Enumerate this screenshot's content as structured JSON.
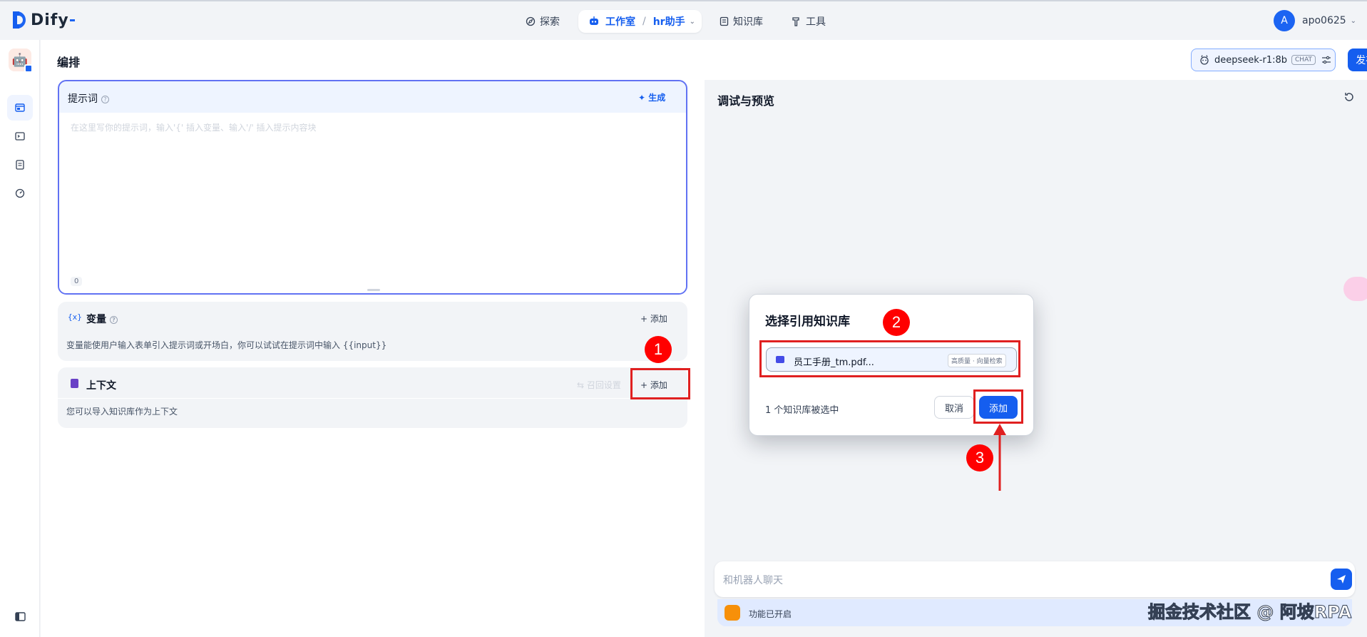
{
  "header": {
    "logo_text": "Dify",
    "nav": {
      "explore": "探索",
      "studio": "工作室",
      "app_name": "hr助手",
      "knowledge": "知识库",
      "tools": "工具"
    },
    "user": {
      "initial": "A",
      "name": "apo0625"
    }
  },
  "main": {
    "title": "编排",
    "model": {
      "name": "deepseek-r1:8b",
      "mode": "CHAT"
    },
    "publish": "发布"
  },
  "prompt": {
    "title": "提示词",
    "generate": "生成",
    "placeholder": "在这里写你的提示词，输入'{' 插入变量、输入'/' 插入提示内容块",
    "count": "0"
  },
  "variables": {
    "icon": "{x}",
    "title": "变量",
    "add": "+ 添加",
    "description": "变量能使用户输入表单引入提示词或开场白，你可以试试在提示词中输入 {{input}}"
  },
  "context": {
    "title": "上下文",
    "recall": "召回设置",
    "add": "+ 添加",
    "description": "您可以导入知识库作为上下文"
  },
  "debug": {
    "title": "调试与预览",
    "chat_placeholder": "和机器人聊天",
    "feature_text": "功能已开启",
    "watermark": "掘金技术社区 @ 阿坡RPA"
  },
  "modal": {
    "title": "选择引用知识库",
    "dataset_name": "员工手册_tm.pdf...",
    "dataset_tag": "高质量 · 向量检索",
    "selected_count": "1 个知识库被选中",
    "cancel": "取消",
    "confirm": "添加"
  },
  "annotations": {
    "step1": "1",
    "step2": "2",
    "step3": "3"
  },
  "colors": {
    "accent": "#155eef",
    "annotation": "#e02020"
  }
}
